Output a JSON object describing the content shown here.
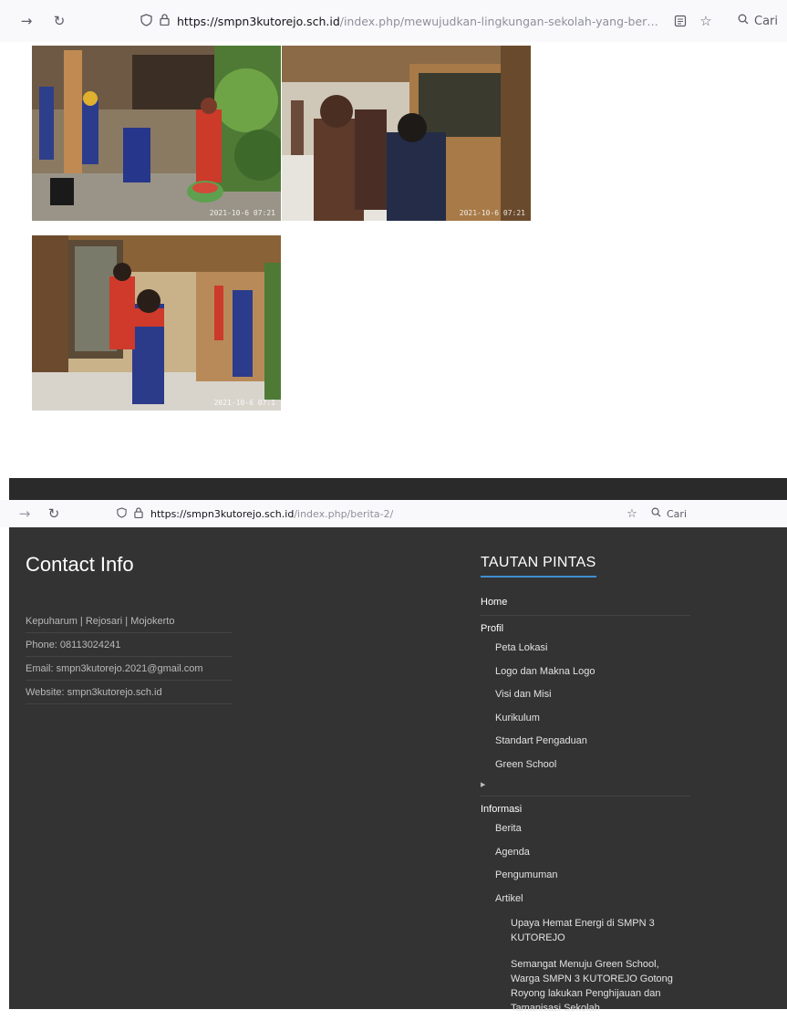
{
  "browser_top": {
    "back_icon": "arrow-right-icon",
    "reload_icon": "reload-icon",
    "url_domain": "https://smpn3kutorejo.sch.id",
    "url_path": "/index.php/mewujudkan-lingkungan-sekolah-yang-bersih-melalui-ju",
    "search_label": "Cari"
  },
  "browser_bottom": {
    "url_domain": "https://smpn3kutorejo.sch.id",
    "url_path": "/index.php/berita-2/",
    "search_label": "Cari"
  },
  "photos": [
    {
      "stamp": "2021-10-6 07:21"
    },
    {
      "stamp": "2021-10-6 07:21"
    },
    {
      "stamp": "2021-10-6 07:1"
    }
  ],
  "footer": {
    "contact_title": "Contact Info",
    "contact_items": [
      "Kepuharum | Rejosari | Mojokerto",
      "Phone: 08113024241",
      "Email: smpn3kutorejo.2021@gmail.com",
      "Website: smpn3kutorejo.sch.id"
    ],
    "links_title": "TAUTAN PINTAS",
    "links": {
      "home": "Home",
      "profil": "Profil",
      "profil_items": [
        "Peta Lokasi",
        "Logo dan Makna Logo",
        "Visi dan Misi",
        "Kurikulum",
        "Standart Pengaduan",
        "Green School"
      ],
      "informasi": "Informasi",
      "informasi_items": [
        "Berita",
        "Agenda",
        "Pengumuman",
        "Artikel"
      ],
      "artikel_items": [
        "Upaya Hemat Energi di SMPN 3 KUTOREJO",
        "Semangat Menuju Green School, Warga SMPN 3 KUTOREJO Gotong Royong lakukan Penghijauan dan Tamanisasi Sekolah"
      ]
    }
  },
  "colors": {
    "footer_bg": "#333333",
    "accent": "#3f8fd0"
  }
}
